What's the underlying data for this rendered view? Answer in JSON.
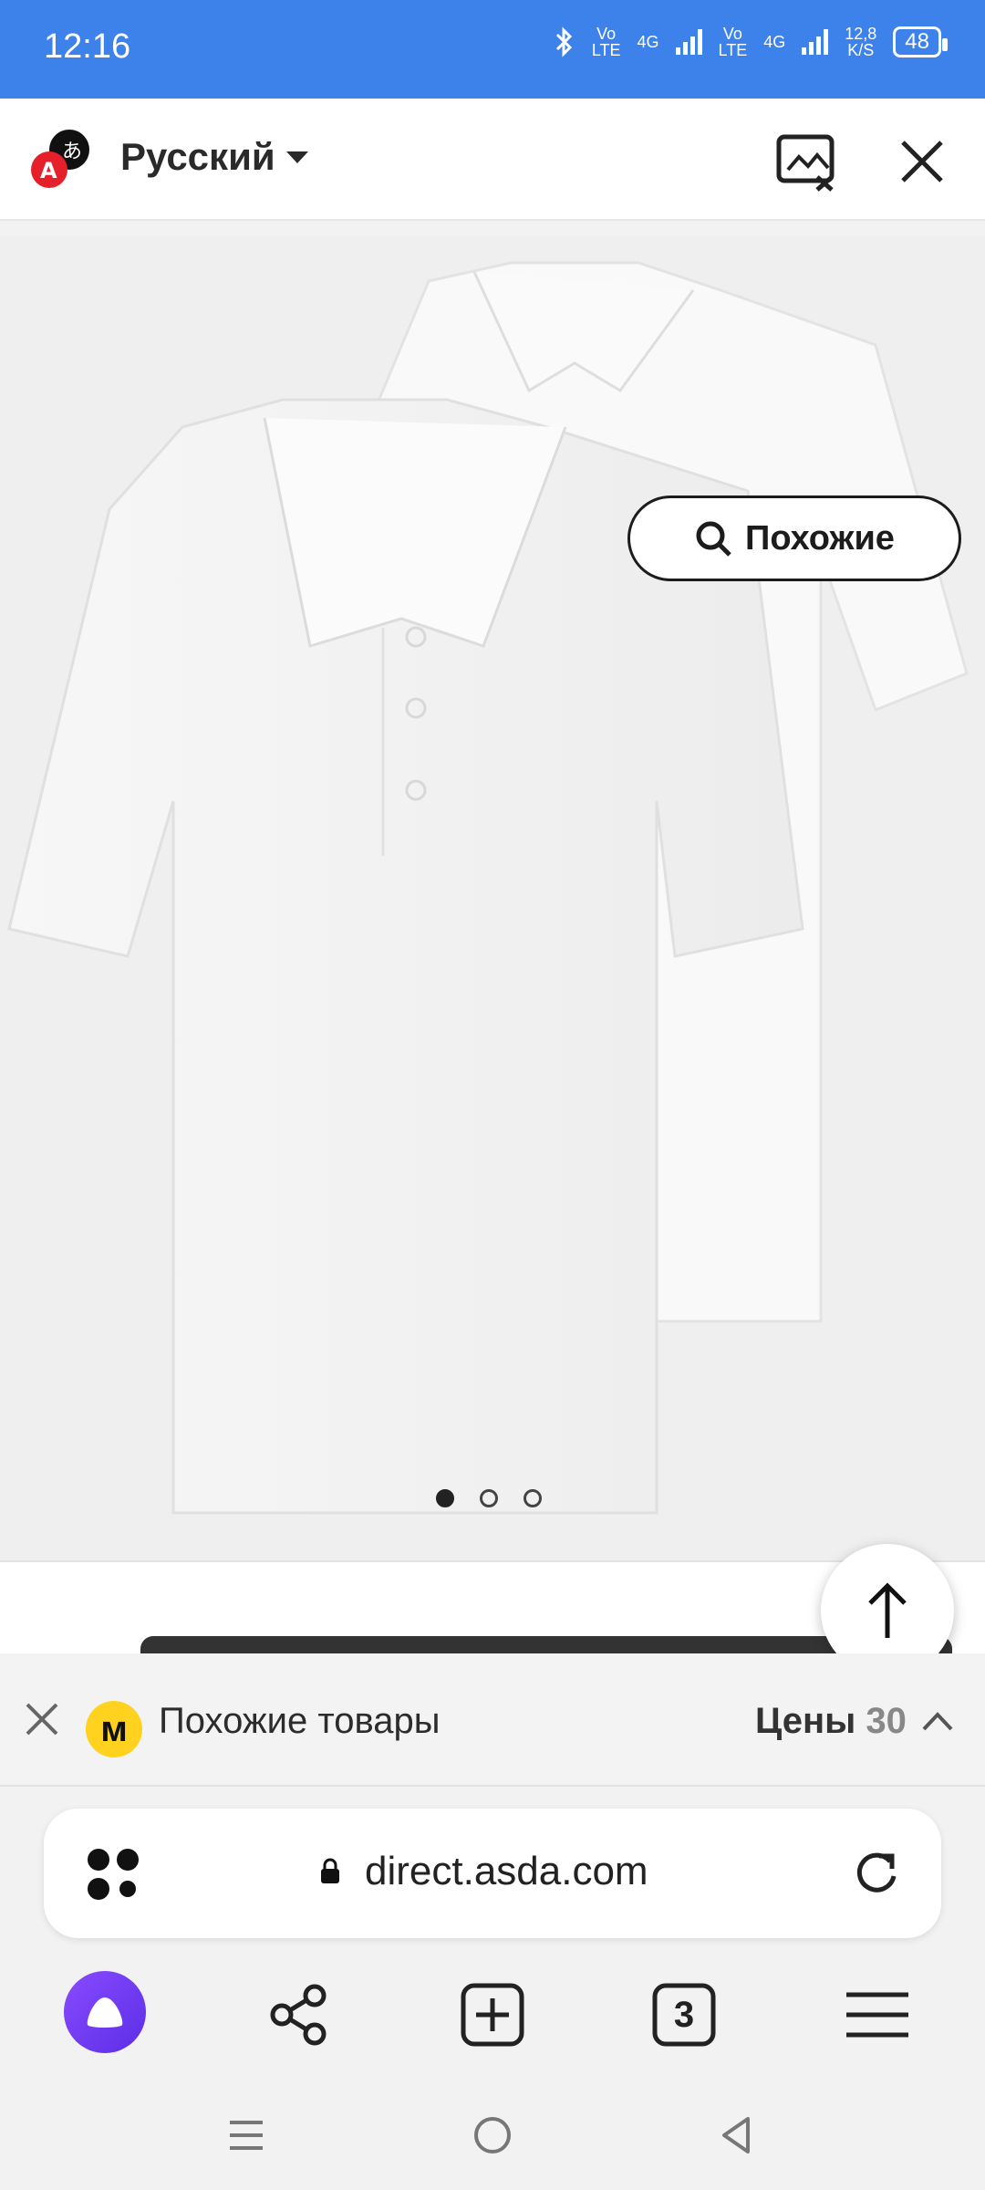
{
  "status_bar": {
    "time": "12:16",
    "sim1_label_top": "Vo",
    "sim1_label_bottom": "LTE",
    "sim1_net": "4G",
    "sim2_label_top": "Vo",
    "sim2_label_bottom": "LTE",
    "sim2_net": "4G",
    "speed_top": "12,8",
    "speed_bottom": "K/S",
    "battery": "48"
  },
  "translate_bar": {
    "language": "Русский"
  },
  "image_viewer": {
    "similar_button_label": "Похожие",
    "image_count": 3,
    "active_index": 0
  },
  "similar_bar": {
    "title": "Похожие товары",
    "prices_label": "Цены",
    "prices_count": "30"
  },
  "address_bar": {
    "url": "direct.asda.com"
  },
  "toolbar": {
    "tabs_count": "3"
  },
  "colors": {
    "status_bar": "#3d82ea",
    "alice": "#6b3cf0",
    "market_logo": "#ffd21f"
  }
}
